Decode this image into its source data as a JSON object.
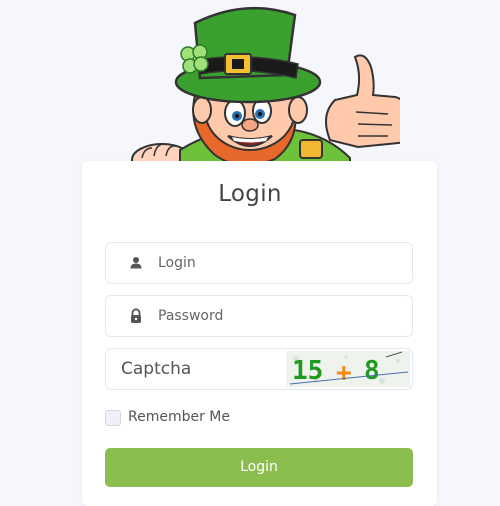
{
  "form": {
    "title": "Login",
    "login_placeholder": "Login",
    "password_placeholder": "Password",
    "captcha_placeholder": "Captcha",
    "captcha_text": "15+8",
    "remember_label": "Remember Me",
    "submit_label": "Login"
  },
  "colors": {
    "background": "#f6f6fd",
    "button": "#8bbd4f",
    "captcha_digits": "#1e9a1e",
    "captcha_plus": "#f08a12"
  },
  "icons": [
    "user-icon",
    "lock-icon"
  ],
  "mascot": "leprechaun-thumbs-up"
}
